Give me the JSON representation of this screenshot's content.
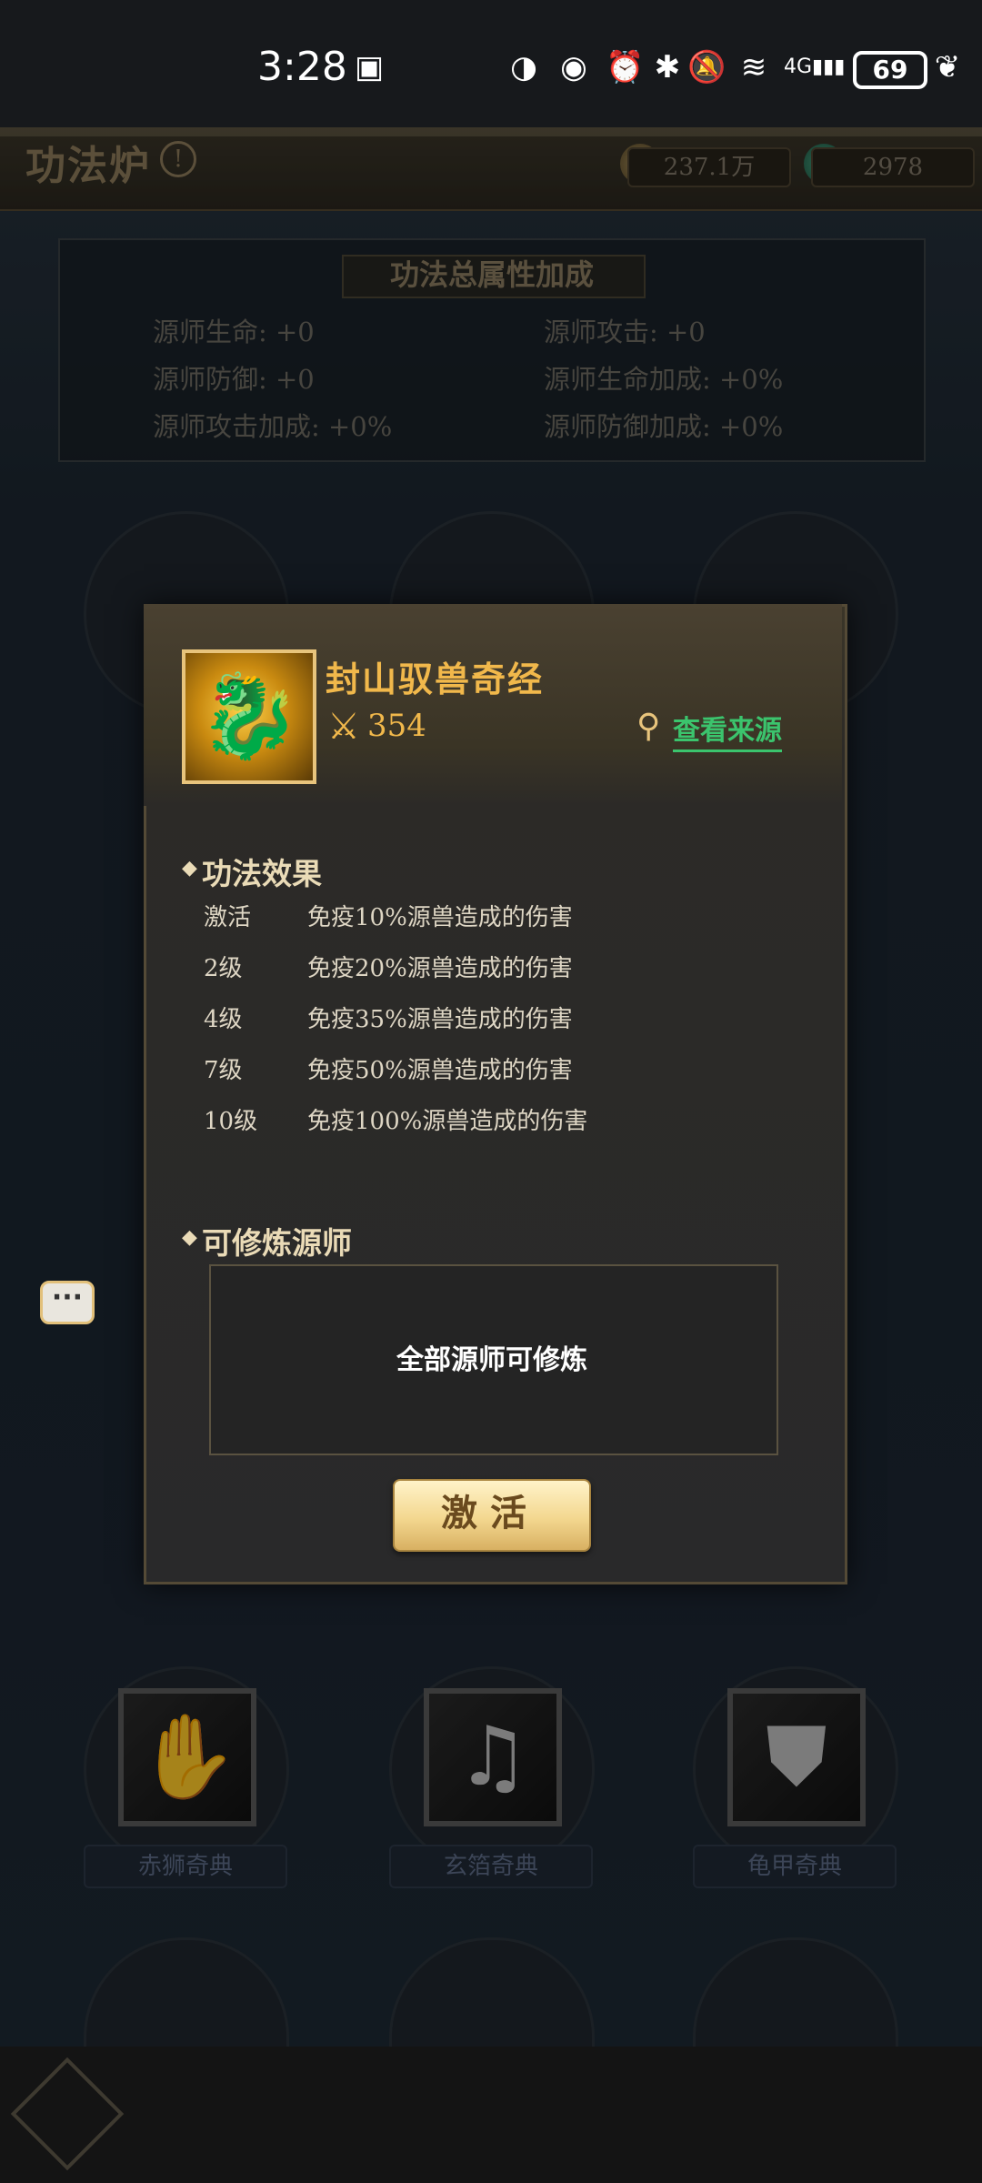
{
  "status_bar": {
    "time": "3:28",
    "battery": "69",
    "network": "4G"
  },
  "header": {
    "title": "功法炉",
    "currency_1": "237.1万",
    "currency_2": "2978"
  },
  "stats": {
    "title": "功法总属性加成",
    "items": [
      "源师生命: +0",
      "源师攻击: +0",
      "源师防御: +0",
      "源师生命加成: +0%",
      "源师攻击加成: +0%",
      "源师防御加成: +0%"
    ]
  },
  "background_slots": {
    "row5": [
      "赤狮奇典",
      "玄箔奇典",
      "龟甲奇典"
    ]
  },
  "modal": {
    "skill_name": "封山驭兽奇经",
    "power": "354",
    "source_link": "查看来源",
    "effects_title": "功法效果",
    "effects": [
      {
        "level": "激活",
        "desc": "免疫10%源兽造成的伤害"
      },
      {
        "level": "2级",
        "desc": "免疫20%源兽造成的伤害"
      },
      {
        "level": "4级",
        "desc": "免疫35%源兽造成的伤害"
      },
      {
        "level": "7级",
        "desc": "免疫50%源兽造成的伤害"
      },
      {
        "level": "10级",
        "desc": "免疫100%源兽造成的伤害"
      }
    ],
    "cultivator_title": "可修炼源师",
    "cultivator_text": "全部源师可修炼",
    "activate_label": "激活"
  }
}
